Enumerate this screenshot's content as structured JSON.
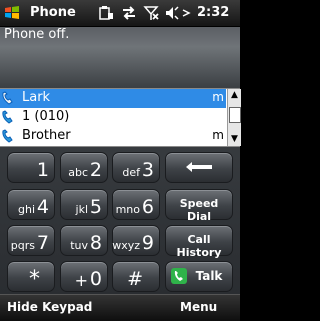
{
  "title_bar": {
    "title": "Phone",
    "time": "2:32",
    "icons": [
      "windows-start-icon",
      "battery-lock-icon",
      "data-sync-icon",
      "signal-off-icon",
      "volume-icon",
      "clock-icon"
    ]
  },
  "status": {
    "message": "Phone off."
  },
  "suggestions": {
    "items": [
      {
        "name": "Lark",
        "type": "m",
        "selected": true
      },
      {
        "name": "1 (010)",
        "type": "",
        "selected": false
      },
      {
        "name": "Brother",
        "type": "m",
        "selected": false
      }
    ]
  },
  "keypad": {
    "keys": [
      {
        "digit": "1",
        "letters": ""
      },
      {
        "digit": "2",
        "letters": "abc"
      },
      {
        "digit": "3",
        "letters": "def"
      },
      {
        "digit": "4",
        "letters": "ghi"
      },
      {
        "digit": "5",
        "letters": "jkl"
      },
      {
        "digit": "6",
        "letters": "mno"
      },
      {
        "digit": "7",
        "letters": "pqrs"
      },
      {
        "digit": "8",
        "letters": "tuv"
      },
      {
        "digit": "9",
        "letters": "wxyz"
      },
      {
        "digit": "*",
        "letters": ""
      },
      {
        "digit": "0",
        "letters": "+"
      },
      {
        "digit": "#",
        "letters": ""
      }
    ],
    "speed_dial_label": "Speed Dial",
    "call_history_label": "Call History",
    "talk_label": "Talk"
  },
  "softkeys": {
    "left": "Hide Keypad",
    "right": "Menu"
  },
  "colors": {
    "selection": "#2f8be6",
    "talk_green": "#2fb34a"
  }
}
